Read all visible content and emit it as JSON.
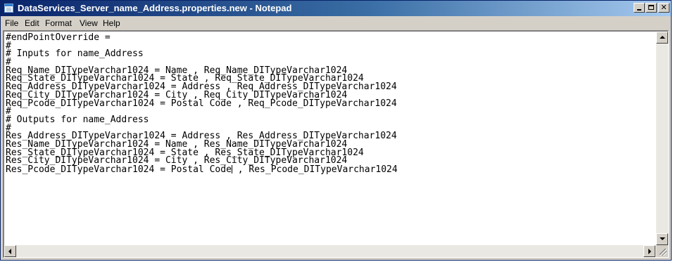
{
  "window": {
    "title": "DataServices_Server_name_Address.properties.new - Notepad",
    "icon": "notepad-icon"
  },
  "menu": {
    "items": [
      {
        "label": "File"
      },
      {
        "label": "Edit"
      },
      {
        "label": "Format"
      },
      {
        "label": "View"
      },
      {
        "label": "Help"
      }
    ]
  },
  "editor": {
    "lines": [
      "#endPointOverride =",
      "#",
      "# Inputs for name_Address",
      "#",
      "Req_Name_DITypeVarchar1024 = Name , Req_Name_DITypeVarchar1024",
      "Req_State_DITypeVarchar1024 = State , Req_State_DITypeVarchar1024",
      "Req_Address_DITypeVarchar1024 = Address , Req_Address_DITypeVarchar1024",
      "Req_City_DITypeVarchar1024 = City , Req_City_DITypeVarchar1024",
      "Req_Pcode_DITypeVarchar1024 = Postal Code , Req_Pcode_DITypeVarchar1024",
      "#",
      "# Outputs for name_Address",
      "#",
      "Res_Address_DITypeVarchar1024 = Address , Res_Address_DITypeVarchar1024",
      "Res_Name_DITypeVarchar1024 = Name , Res_Name_DITypeVarchar1024",
      "Res_State_DITypeVarchar1024 = State , Res_State_DITypeVarchar1024",
      "Res_City_DITypeVarchar1024 = City , Res_City_DITypeVarchar1024"
    ],
    "last_line_before_caret": "Res_Pcode_DITypeVarchar1024 = Postal Code",
    "last_line_after_caret": " , Res_Pcode_DITypeVarchar1024"
  },
  "colors": {
    "titlebar_start": "#0a246a",
    "titlebar_end": "#a6caf0",
    "chrome": "#d4d0c8"
  }
}
